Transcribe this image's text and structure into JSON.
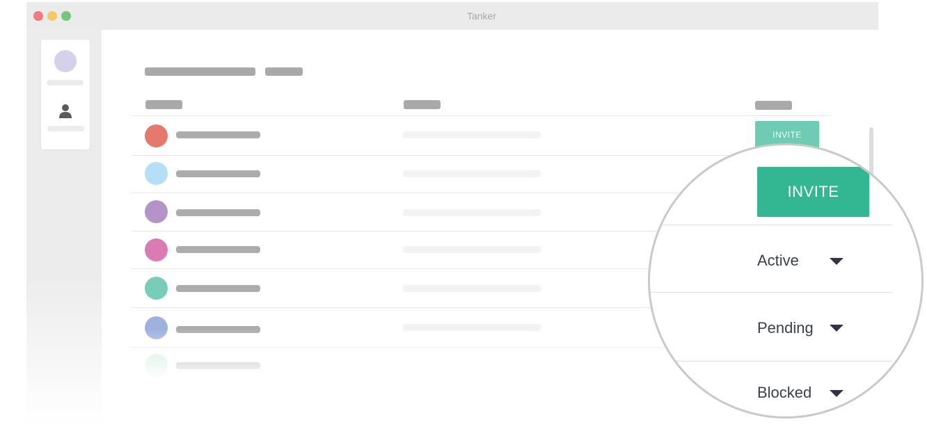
{
  "window": {
    "title": "Tanker"
  },
  "colors": {
    "accent_green": "#33b793",
    "light_green": "#6fcbb3",
    "placeholder_gray": "#a9a9a9"
  },
  "sidebar": {
    "icons": [
      "avatar",
      "user-icon"
    ]
  },
  "table": {
    "rows": [
      {
        "avatar_color": "#e6786c"
      },
      {
        "avatar_color": "#b6def6"
      },
      {
        "avatar_color": "#b494c8"
      },
      {
        "avatar_color": "#da7bb3"
      },
      {
        "avatar_color": "#78cdb8"
      },
      {
        "avatar_color": "#9fb1de"
      },
      {
        "avatar_color": "#cdebdd"
      }
    ],
    "row_action_label": "INVITE"
  },
  "magnifier": {
    "invite_label": "INVITE",
    "statuses": [
      {
        "label": "Active"
      },
      {
        "label": "Pending"
      },
      {
        "label": "Blocked"
      }
    ]
  }
}
